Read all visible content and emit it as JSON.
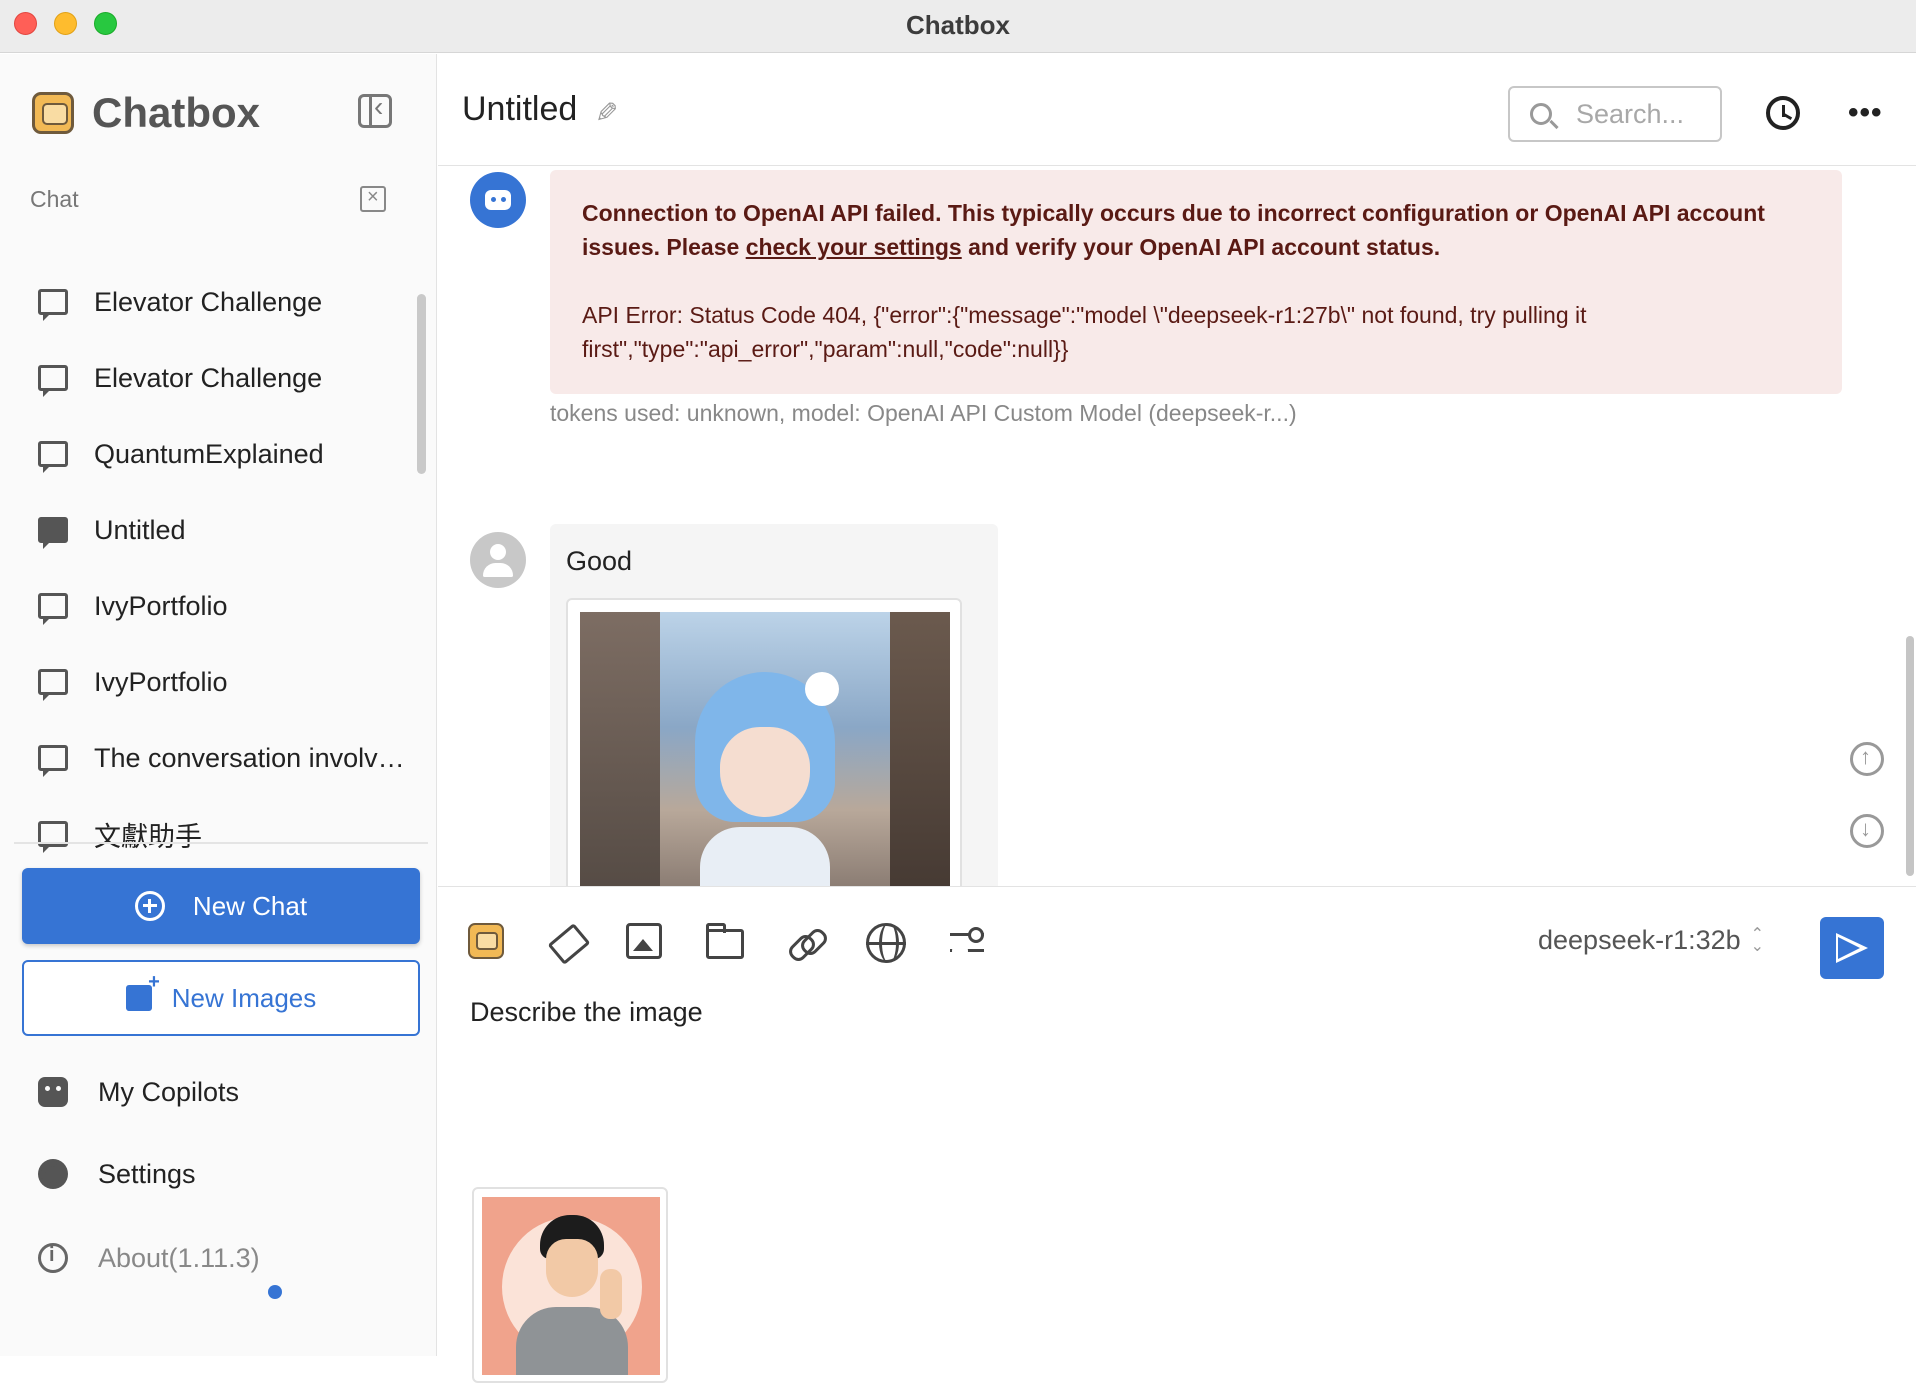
{
  "window": {
    "title": "Chatbox"
  },
  "sidebar": {
    "brand": "Chatbox",
    "section_label": "Chat",
    "chats": [
      {
        "label": "Elevator Challenge",
        "icon": "chat-bubble-icon"
      },
      {
        "label": "Elevator Challenge",
        "icon": "chat-bubble-icon"
      },
      {
        "label": "QuantumExplained",
        "icon": "chat-bubble-icon"
      },
      {
        "label": "Untitled",
        "icon": "image-icon"
      },
      {
        "label": "IvyPortfolio",
        "icon": "chat-bubble-icon"
      },
      {
        "label": "IvyPortfolio",
        "icon": "chat-bubble-icon"
      },
      {
        "label": "The conversation involves...",
        "icon": "chat-bubble-icon"
      },
      {
        "label": "文獻助手",
        "icon": "chat-bubble-icon"
      }
    ],
    "new_chat_label": "New Chat",
    "new_images_label": "New Images",
    "nav": {
      "copilots": "My Copilots",
      "settings": "Settings",
      "about": "About(1.11.3)"
    }
  },
  "header": {
    "title": "Untitled",
    "search_placeholder": "Search..."
  },
  "messages": {
    "error": {
      "main_before_link": "Connection to OpenAI API failed. This typically occurs due to incorrect configuration or OpenAI API account issues. Please ",
      "link_text": "check your settings",
      "main_after_link": " and verify your OpenAI API account status.",
      "detail": "API Error: Status Code 404, {\"error\":{\"message\":\"model \\\"deepseek-r1:27b\\\" not found, try pulling it first\",\"type\":\"api_error\",\"param\":null,\"code\":null}}"
    },
    "tokens_info": "tokens used: unknown, model: OpenAI API Custom Model (deepseek-r...)",
    "user_message": "Good"
  },
  "composer": {
    "model": "deepseek-r1:32b",
    "input_value": "Describe the image"
  },
  "colors": {
    "accent": "#3674d4",
    "error_bg": "#f8eae9",
    "error_text": "#5a1a14"
  }
}
